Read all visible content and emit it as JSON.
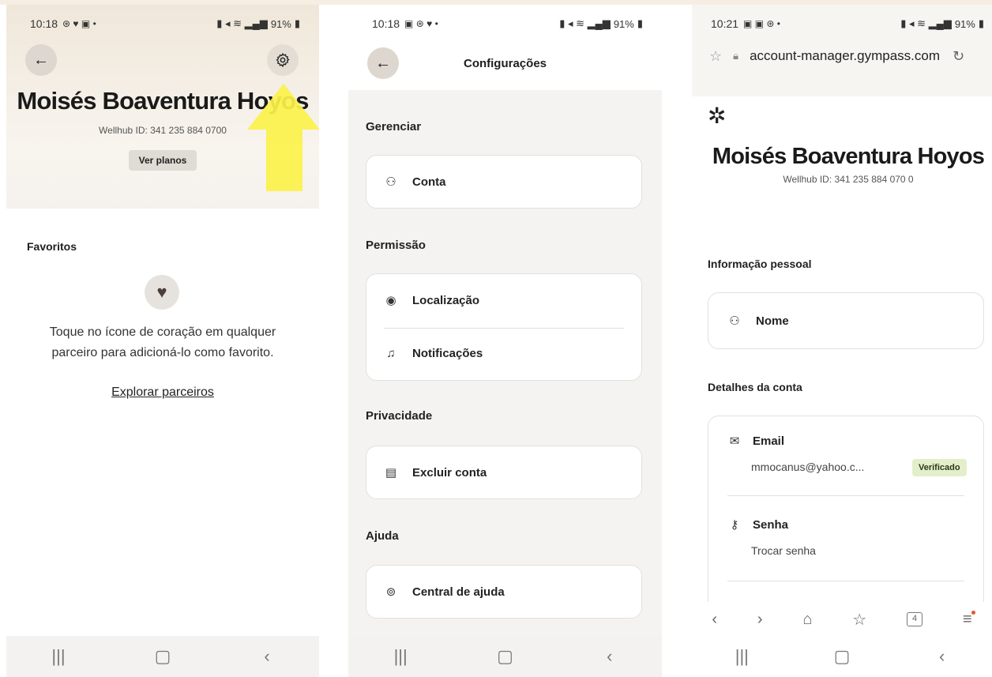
{
  "phone1": {
    "status": {
      "time": "10:18",
      "icons_left": "⊛ ♥ ▣ •",
      "battery": "91%"
    },
    "profile_name": "Moisés Boaventura Hoyos",
    "wellhub_id": "Wellhub ID: 341 235 884 0700",
    "plans_button": "Ver planos",
    "favorites_title": "Favoritos",
    "empty_text_line1": "Toque no ícone de coração em qualquer",
    "empty_text_line2": "parceiro para adicioná-lo como favorito.",
    "explore_link": "Explorar parceiros"
  },
  "phone2": {
    "status": {
      "time": "10:18",
      "icons_left": "▣ ⊛ ♥ •",
      "battery": "91%"
    },
    "title": "Configurações",
    "sections": {
      "manage": "Gerenciar",
      "permission": "Permissão",
      "privacy": "Privacidade",
      "help": "Ajuda"
    },
    "items": {
      "account": "Conta",
      "location": "Localização",
      "notifications": "Notificações",
      "delete_account": "Excluir conta",
      "help_center": "Central de ajuda"
    }
  },
  "phone3": {
    "status": {
      "time": "10:21",
      "icons_left": "▣ ▣ ⊛ •",
      "battery": "91%"
    },
    "url": "account-manager.gympass.com",
    "profile_name": "Moisés Boaventura Hoyos",
    "wellhub_id": "Wellhub ID: 341 235 884 070 0",
    "personal_info_title": "Informação pessoal",
    "name_label": "Nome",
    "account_details_title": "Detalhes da conta",
    "email_label": "Email",
    "email_value": "mmocanus@yahoo.c...",
    "verified_badge": "Verificado",
    "password_label": "Senha",
    "password_action": "Trocar senha",
    "tab_count": "4"
  },
  "colors": {
    "accent_yellow": "#fbf24a",
    "badge_green": "#e3eeca",
    "chip_bg": "#e6e3de"
  },
  "icons": [
    "back-arrow-icon",
    "settings-gear-icon",
    "heart-icon",
    "person-icon",
    "location-pin-icon",
    "bell-icon",
    "document-icon",
    "help-circle-icon",
    "mail-icon",
    "key-icon",
    "star-icon",
    "lock-icon",
    "reload-icon",
    "home-icon",
    "tabs-icon",
    "menu-icon",
    "wellhub-logo-icon"
  ]
}
